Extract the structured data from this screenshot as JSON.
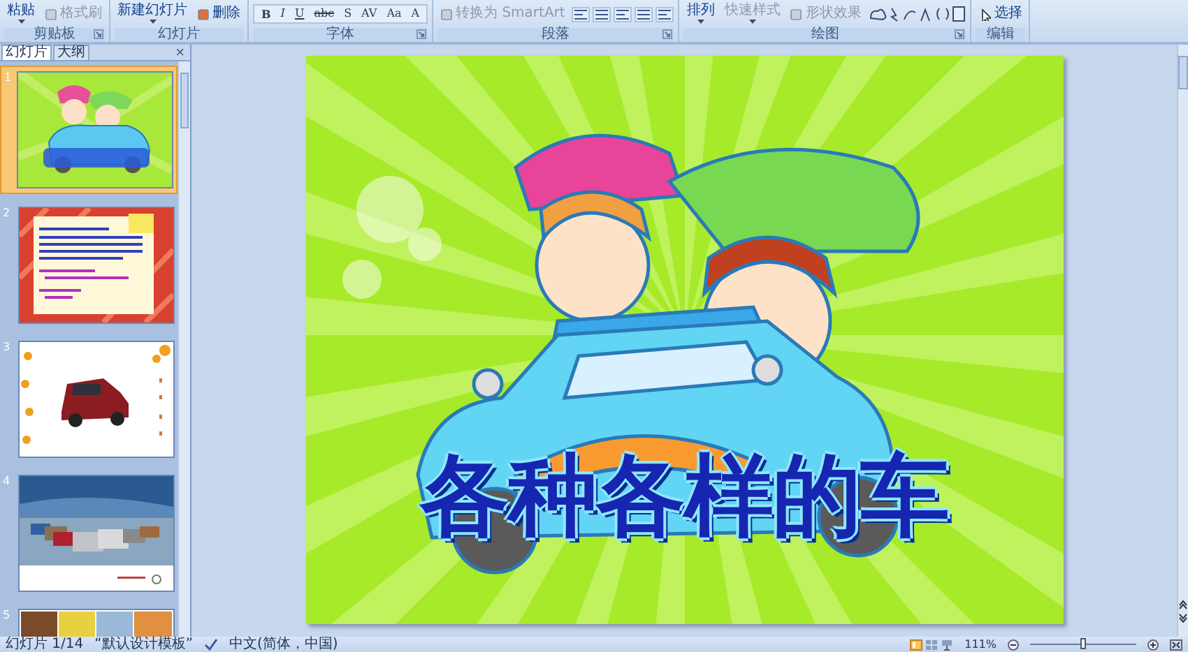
{
  "ribbon": {
    "groups": [
      {
        "kind": "clipboard",
        "label": "剪贴板",
        "launcher": true,
        "items": [
          {
            "kind": "big",
            "label": "粘贴",
            "disabled": false
          },
          {
            "kind": "small",
            "label": "格式刷",
            "disabled": true
          }
        ]
      },
      {
        "kind": "slides",
        "label": "幻灯片",
        "launcher": false,
        "items": [
          {
            "kind": "big",
            "label": "新建幻灯片",
            "disabled": false
          },
          {
            "kind": "small",
            "label": "删除",
            "disabled": false
          }
        ]
      },
      {
        "kind": "font",
        "label": "字体",
        "launcher": true,
        "items": [
          {
            "kind": "glyph",
            "label": "B",
            "disabled": false
          },
          {
            "kind": "glyph",
            "label": "I",
            "disabled": false
          },
          {
            "kind": "glyph",
            "label": "U",
            "disabled": false
          },
          {
            "kind": "glyph",
            "label": "abc",
            "disabled": false
          },
          {
            "kind": "glyph",
            "label": "S",
            "disabled": false
          },
          {
            "kind": "glyph",
            "label": "AV",
            "disabled": false
          },
          {
            "kind": "glyph",
            "label": "Aa",
            "disabled": false
          },
          {
            "kind": "glyph",
            "label": "A",
            "disabled": false
          }
        ]
      },
      {
        "kind": "paragraph",
        "label": "段落",
        "launcher": true,
        "items": [
          {
            "kind": "small",
            "label": "转换为 SmartArt",
            "disabled": true
          }
        ]
      },
      {
        "kind": "drawing",
        "label": "绘图",
        "launcher": true,
        "items": [
          {
            "kind": "big",
            "label": "排列",
            "disabled": false
          },
          {
            "kind": "big",
            "label": "快速样式",
            "disabled": true
          },
          {
            "kind": "small",
            "label": "形状效果",
            "disabled": true
          }
        ]
      },
      {
        "kind": "editing",
        "label": "编辑",
        "launcher": false,
        "items": [
          {
            "kind": "small",
            "label": "选择",
            "disabled": false
          }
        ]
      }
    ]
  },
  "pane": {
    "tabs": [
      {
        "label": "幻灯片",
        "selected": true
      },
      {
        "label": "大纲",
        "selected": false
      }
    ],
    "close": "×",
    "thumbnails": [
      {
        "number": "1",
        "kind": "title-art",
        "selected": true
      },
      {
        "number": "2",
        "kind": "letter",
        "selected": false
      },
      {
        "number": "3",
        "kind": "car",
        "selected": false
      },
      {
        "number": "4",
        "kind": "cars",
        "selected": false
      },
      {
        "number": "5",
        "kind": "grid",
        "selected": false
      }
    ]
  },
  "slide": {
    "title": "各种各样的车"
  },
  "status_bar": {
    "slide": "幻灯片 1/14",
    "theme": "“默认设计模板”",
    "language": "中文(简体，中国)",
    "zoom": "111%",
    "zoom_slider": {
      "level": 0.5
    }
  }
}
